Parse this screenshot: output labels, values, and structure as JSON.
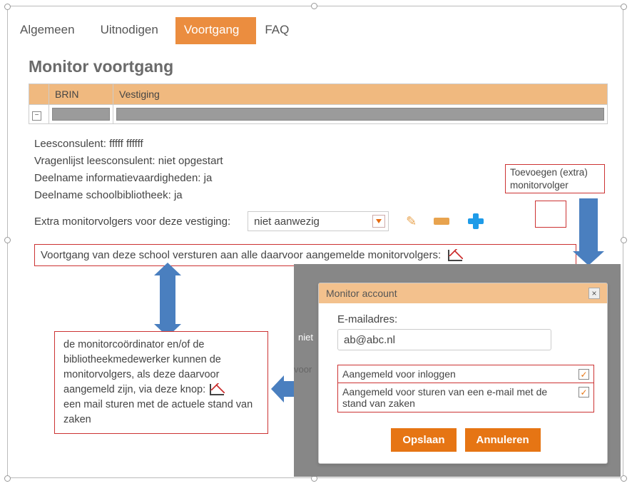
{
  "tabs": [
    "Algemeen",
    "Uitnodigen",
    "Voortgang",
    "FAQ"
  ],
  "active_tab": 2,
  "title": "Monitor voortgang",
  "table": {
    "headers": [
      "BRIN",
      "Vestiging"
    ]
  },
  "meta": {
    "line1": "Leesconsulent: fffff ffffff",
    "line2": "Vragenlijst leesconsulent: niet opgestart",
    "line3": "Deelname informatievaardigheden: ja",
    "line4": "Deelname schoolbibliotheek: ja"
  },
  "extra": {
    "label": "Extra monitorvolgers voor deze vestiging:",
    "dropdown_value": "niet aanwezig"
  },
  "send_label": "Voortgang van deze school versturen aan alle daarvoor aangemelde monitorvolgers:",
  "callout_add": "Toevoegen (extra)\nmonitorvolger",
  "explain_prefix": "de monitorcoördinator en/of de bibliotheekmedewerker kunnen de monitorvolgers, als deze daarvoor aangemeld zijn, via deze knop:",
  "explain_suffix": "een mail sturen met de actuele stand van zaken",
  "modal": {
    "title": "Monitor account",
    "email_label": "E-mailadres:",
    "email_value": "ab@abc.nl",
    "chk1": "Aangemeld voor inloggen",
    "chk2": "Aangemeld voor sturen van een e-mail met de stand van zaken",
    "save": "Opslaan",
    "cancel": "Annuleren"
  },
  "strips": {
    "niet": "niet",
    "voor": "voor"
  }
}
